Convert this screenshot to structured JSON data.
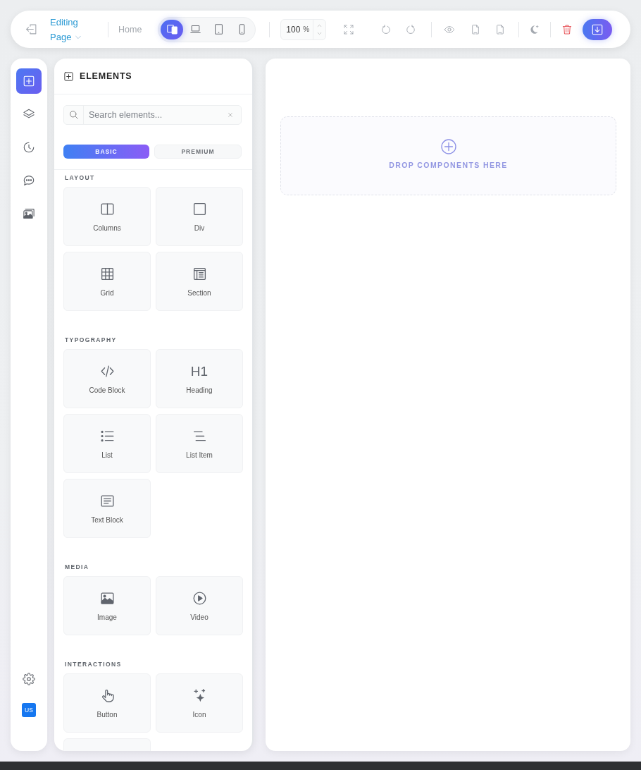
{
  "toolbar": {
    "page_selector": "Editing Page",
    "breadcrumb": "Home",
    "devices": [
      {
        "kind": "responsive",
        "selected": true
      },
      {
        "kind": "laptop",
        "selected": false
      },
      {
        "kind": "tablet",
        "selected": false
      },
      {
        "kind": "mobile",
        "selected": false
      }
    ],
    "zoom": {
      "value": "100",
      "unit": "%"
    }
  },
  "sidebar": {
    "items": [
      {
        "kind": "add",
        "selected": true
      },
      {
        "kind": "layers",
        "selected": false
      },
      {
        "kind": "history",
        "selected": false
      },
      {
        "kind": "comments",
        "selected": false
      },
      {
        "kind": "media",
        "selected": false
      }
    ],
    "user_badge": "US"
  },
  "panel": {
    "title": "ELEMENTS",
    "search": {
      "placeholder": "Search elements..."
    },
    "tabs": [
      {
        "label": "BASIC",
        "selected": true
      },
      {
        "label": "PREMIUM",
        "selected": false
      }
    ],
    "sections": [
      {
        "title": "LAYOUT",
        "items": [
          {
            "kind": "columns",
            "label": "Columns"
          },
          {
            "kind": "div",
            "label": "Div"
          },
          {
            "kind": "grid",
            "label": "Grid"
          },
          {
            "kind": "section",
            "label": "Section"
          }
        ]
      },
      {
        "title": "TYPOGRAPHY",
        "heading_glyph": "H1",
        "items": [
          {
            "kind": "code",
            "label": "Code Block"
          },
          {
            "kind": "heading",
            "label": "Heading"
          },
          {
            "kind": "list",
            "label": "List"
          },
          {
            "kind": "list_item",
            "label": "List Item"
          },
          {
            "kind": "text_block",
            "label": "Text Block"
          }
        ]
      },
      {
        "title": "MEDIA",
        "items": [
          {
            "kind": "image",
            "label": "Image"
          },
          {
            "kind": "video",
            "label": "Video"
          }
        ]
      },
      {
        "title": "INTERACTIONS",
        "items": [
          {
            "kind": "button",
            "label": "Button"
          },
          {
            "kind": "icon",
            "label": "Icon"
          }
        ],
        "partial_card": true
      }
    ]
  },
  "canvas": {
    "drop_zone": "DROP COMPONENTS HERE"
  }
}
